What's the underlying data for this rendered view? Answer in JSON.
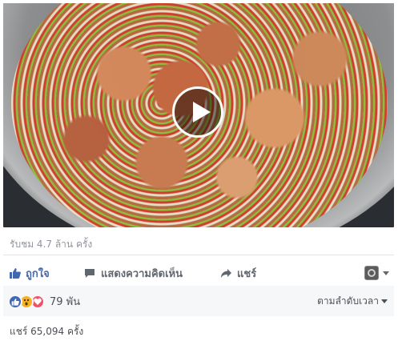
{
  "video": {
    "play_icon": "play-icon"
  },
  "stats": {
    "views": "รับชม 4.7 ล้าน ครั้ง"
  },
  "actions": {
    "like_label": "ถูกใจ",
    "like_icon": "thumbs-up-icon",
    "comment_label": "แสดงความคิดเห็น",
    "comment_icon": "comment-icon",
    "share_label": "แชร์",
    "share_icon": "share-arrow-icon",
    "page_selector_icon": "page-avatar-icon"
  },
  "reactions": {
    "types": [
      "like",
      "wow",
      "love"
    ],
    "count": "79 พัน",
    "sort_label": "ตามลำดับเวลา"
  },
  "shares": {
    "label": "แชร์ 65,094 ครั้ง"
  },
  "colors": {
    "like_blue": "#4267b2",
    "love_red": "#f25268",
    "wow_yellow": "#f7b125"
  }
}
